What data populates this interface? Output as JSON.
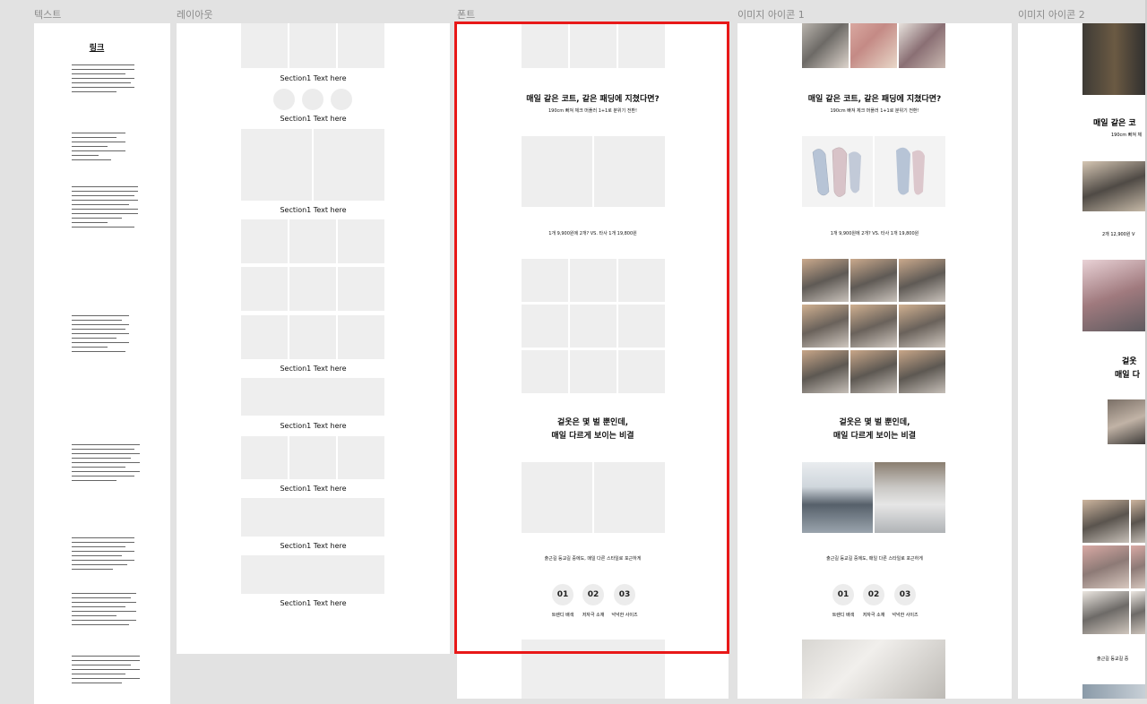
{
  "columns": [
    {
      "label": "텍스트"
    },
    {
      "label": "레이아웃"
    },
    {
      "label": "폰트"
    },
    {
      "label": "이미지 아이콘 1"
    },
    {
      "label": "이미지 아이콘 2"
    }
  ],
  "text_frame": {
    "title": "링크"
  },
  "layout_frame": {
    "section_text": "Section1 Text here"
  },
  "font_frame": {
    "headline1": "매일 같은 코트, 같은 패딩에 지쳤다면?",
    "sub1": "190cm 빠져 체크 머플러 1+1로 분위기 전환!",
    "price_line": "1개 9,900원에 2개?  VS.  타사 1개 19,800원",
    "headline2_line1": "겉옷은 몇 벌 뿐인데,",
    "headline2_line2": "매일 다르게 보이는 비결",
    "commute_text": "출근길 등교길 중에도, 매일 다른 스타일로 포근하게",
    "features": [
      {
        "num": "01",
        "label": "트렌디 배색"
      },
      {
        "num": "02",
        "label": "저자극 소재"
      },
      {
        "num": "03",
        "label": "넉넉한 사이즈"
      }
    ]
  },
  "image_frame2": {
    "headline1_partial": "매일 같은 코",
    "sub1_partial": "190cm 빠져 체",
    "price_partial": "2개 12,900원  V",
    "headline2_partial_1": "겉옷",
    "headline2_partial_2": "매일 다",
    "commute_partial": "출근길 등교길 중"
  },
  "colors": {
    "highlight": "#e81818",
    "canvas_bg": "#e2e2e2",
    "placeholder": "#eeeeee"
  }
}
